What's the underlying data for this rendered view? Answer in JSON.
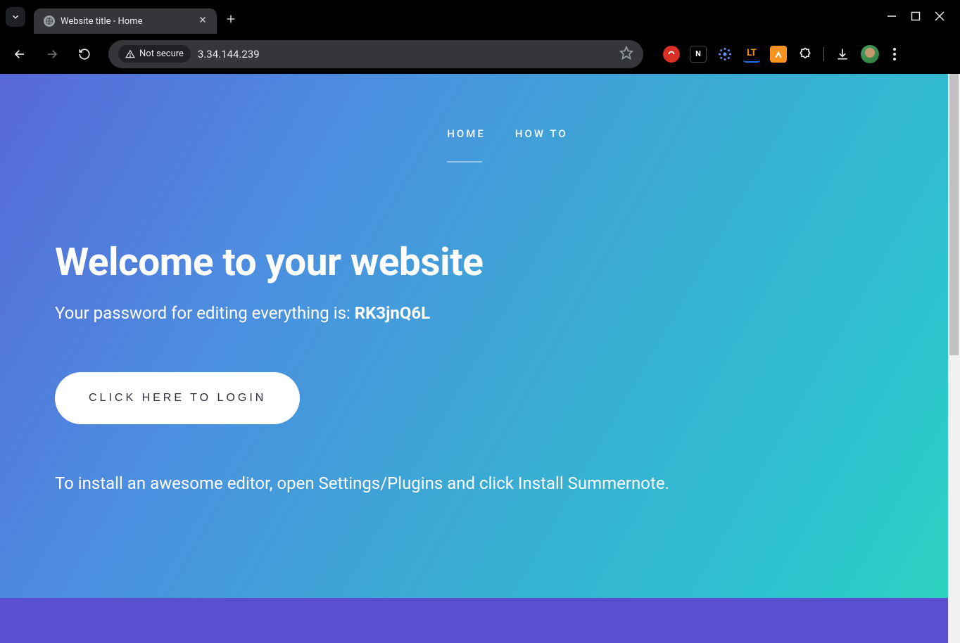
{
  "browser": {
    "tab_title": "Website title - Home",
    "security_label": "Not secure",
    "url": "3.34.144.239"
  },
  "page": {
    "nav": {
      "home": "HOME",
      "how_to": "HOW TO"
    },
    "headline": "Welcome to your website",
    "subtitle_prefix": "Your password for editing everything is: ",
    "subtitle_password": "RK3jnQ6L",
    "cta_label": "CLICK HERE TO LOGIN",
    "hint": "To install an awesome editor, open Settings/Plugins and click Install Summernote."
  }
}
